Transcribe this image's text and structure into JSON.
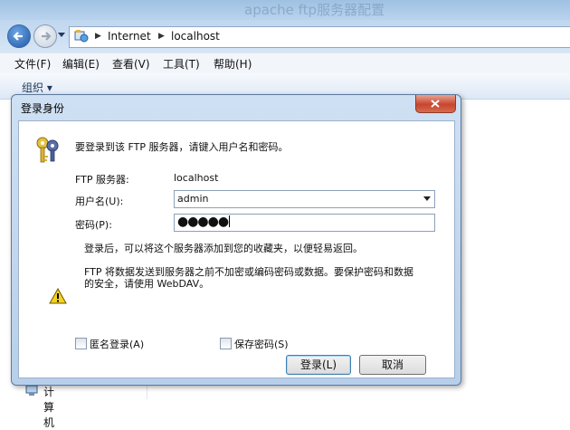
{
  "window": {
    "title": "apache ftp服务器配置"
  },
  "nav": {
    "crumbs": [
      "Internet",
      "localhost"
    ]
  },
  "menu": {
    "items": [
      "文件(F)",
      "编辑(E)",
      "查看(V)",
      "工具(T)",
      "帮助(H)"
    ]
  },
  "toolbar": {
    "organize_label": "组织 ▾"
  },
  "leftpane": {
    "computer_label": "计算机"
  },
  "dialog": {
    "title": "登录身份",
    "prompt": "要登录到该 FTP 服务器，请键入用户名和密码。",
    "server_label": "FTP 服务器:",
    "server_value": "localhost",
    "username_label": "用户名(U):",
    "username_value": "admin",
    "password_label": "密码(P):",
    "password_mask": "●●●●●",
    "info_text": "登录后，可以将这个服务器添加到您的收藏夹，以便轻易返回。",
    "warning_line1": "FTP 将数据发送到服务器之前不加密或编码密码或数据。要保护密码和数据",
    "warning_line2": "的安全，请使用 WebDAV。",
    "anonymous_label": "匿名登录(A)",
    "save_password_label": "保存密码(S)",
    "login_button": "登录(L)",
    "cancel_button": "取消"
  },
  "icons": {
    "back": "back-arrow-icon",
    "forward": "forward-arrow-icon",
    "close": "close-icon",
    "keys": "keys-icon",
    "warning": "warning-icon"
  }
}
